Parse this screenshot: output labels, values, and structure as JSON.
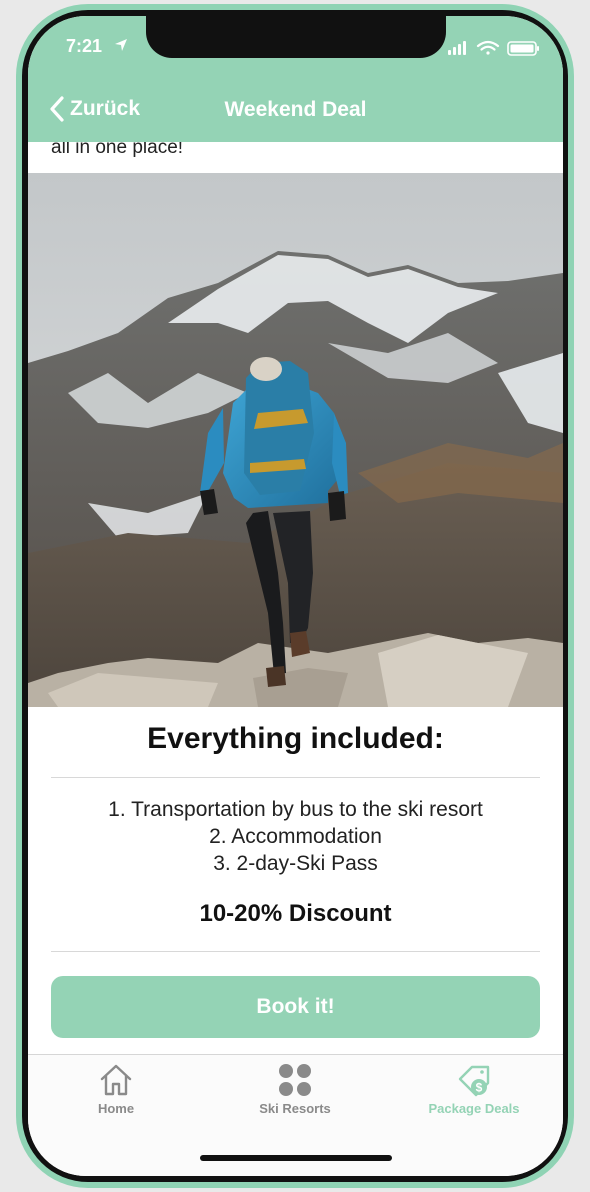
{
  "status_bar": {
    "time": "7:21"
  },
  "nav": {
    "back_label": "Zurück",
    "title": "Weekend Deal"
  },
  "intro": {
    "tail_text": "all in one place!"
  },
  "hero_image": {
    "description_icon": "mountain-hiker-photo"
  },
  "included": {
    "title": "Everything included:",
    "items": [
      "1. Transportation by bus to the ski resort",
      "2. Accommodation",
      "3. 2-day-Ski Pass"
    ],
    "discount": "10-20% Discount"
  },
  "actions": {
    "book_label": "Book it!"
  },
  "tabbar": {
    "tabs": [
      {
        "label": "Home",
        "icon": "home-icon",
        "active": false
      },
      {
        "label": "Ski Resorts",
        "icon": "dots-grid-icon",
        "active": false
      },
      {
        "label": "Package Deals",
        "icon": "price-tag-icon",
        "active": true
      }
    ]
  },
  "colors": {
    "accent": "#94d3b5",
    "frame": "#8fd3b4",
    "inactive_tab": "#8a8a8a"
  }
}
